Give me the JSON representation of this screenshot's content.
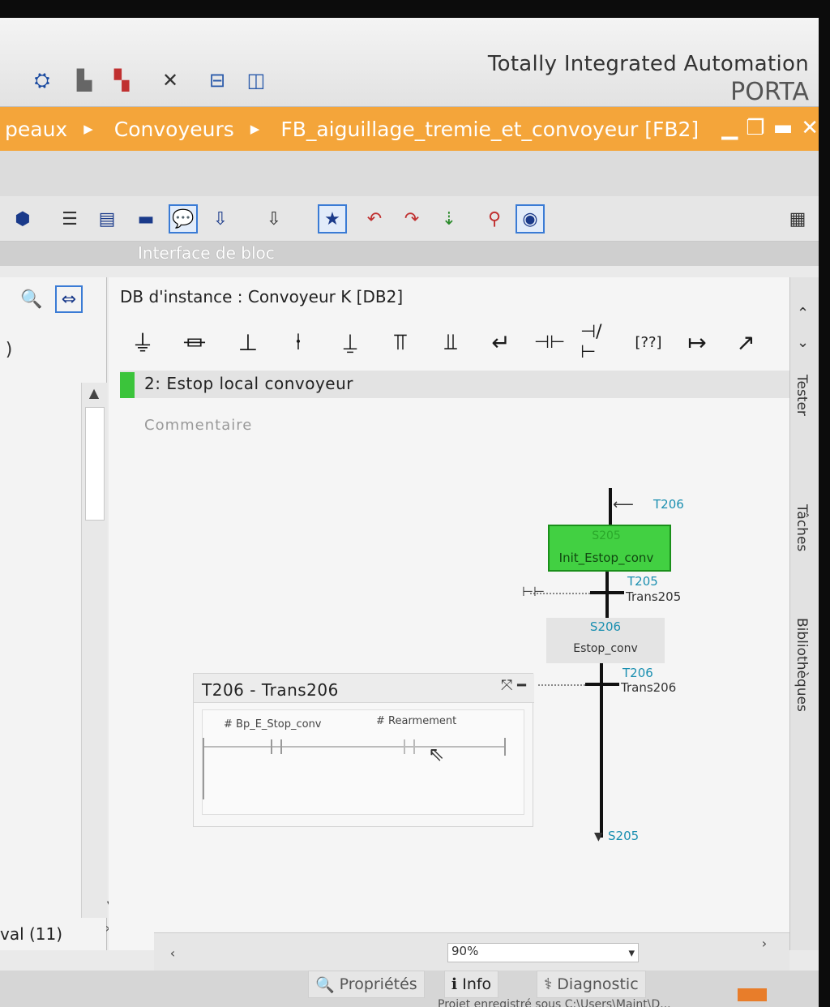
{
  "header": {
    "title_line1": "Totally Integrated Automation",
    "title_line2": "PORTA"
  },
  "breadcrumb": {
    "items": [
      "peaux",
      "Convoyeurs",
      "FB_aiguillage_tremie_et_convoyeur [FB2]"
    ]
  },
  "block_interface_label": "Interface de bloc",
  "editor": {
    "instance_db": "DB d'instance : Convoyeur K [DB2]",
    "network_title": "2:  Estop local convoyeur",
    "network_comment": "Commentaire",
    "zoom": "90%"
  },
  "graph": {
    "top_transition": "T206",
    "step1": {
      "id": "S205",
      "name": "Init_Estop_conv"
    },
    "trans1": {
      "id": "T205",
      "name": "Trans205"
    },
    "step2": {
      "id": "S206",
      "name": "Estop_conv"
    },
    "trans2": {
      "id": "T206",
      "name": "Trans206"
    },
    "jump_target": "S205"
  },
  "transition_popup": {
    "title": "T206 - Trans206",
    "contact1": "# Bp_E_Stop_conv",
    "contact2": "# Rearmement"
  },
  "left_panel": {
    "bottom_text": "val (11)"
  },
  "side_tabs": [
    "Tester",
    "Tâches",
    "Bibliothèques"
  ],
  "bottom_tabs": {
    "properties": "Propriétés",
    "info": "Info",
    "diagnostic": "Diagnostic"
  },
  "status": {
    "saved_text": "Projet enregistré sous C:\\Users\\Maint\\D..."
  }
}
